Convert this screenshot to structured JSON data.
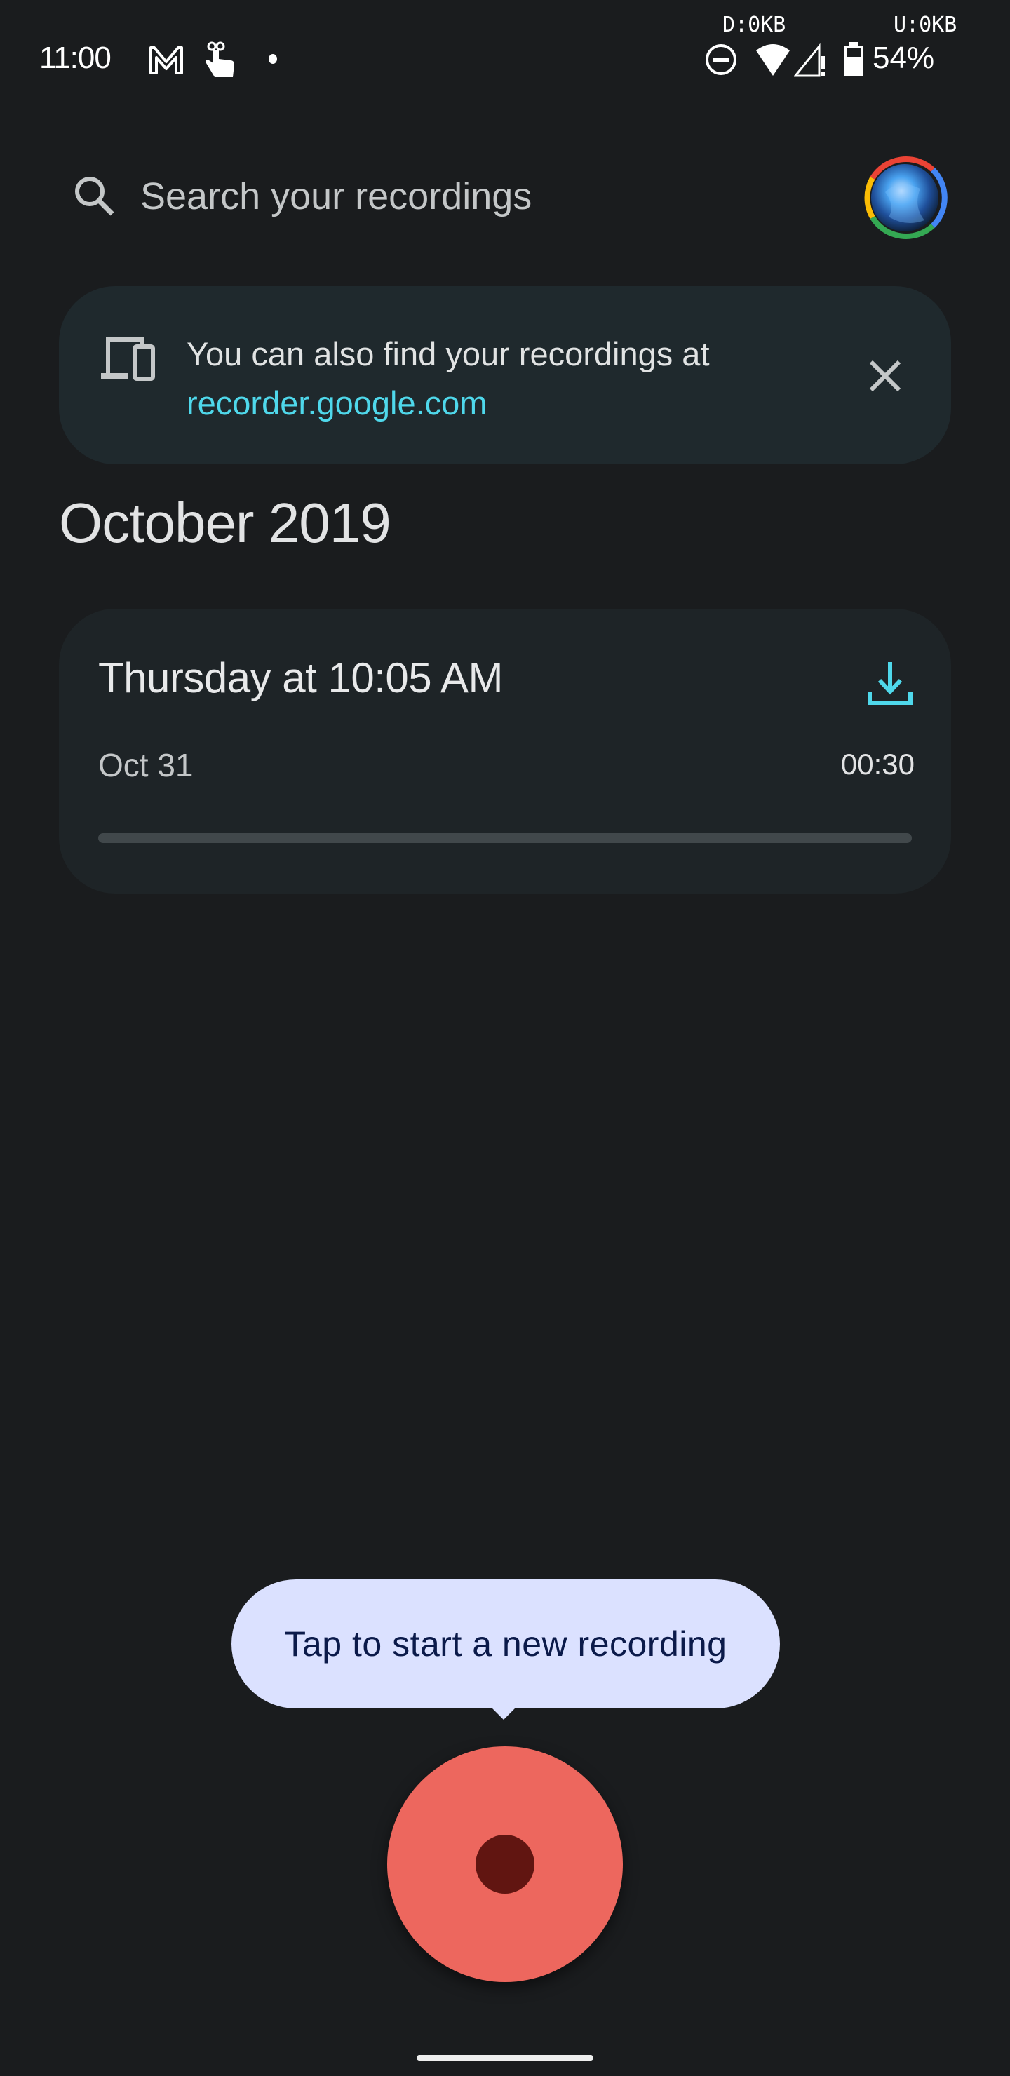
{
  "status_bar": {
    "time": "11:00",
    "notification_icons": [
      "gmail-icon",
      "touch-gesture-icon",
      "more-notifications-dot"
    ],
    "download_rate": "D:0KB",
    "upload_rate": "U:0KB",
    "system_icons": [
      "do-not-disturb-icon",
      "wifi-icon",
      "cellular-no-signal-icon",
      "battery-icon"
    ],
    "battery_percent": "54%"
  },
  "search": {
    "placeholder": "Search your recordings",
    "icon": "search-icon"
  },
  "account": {
    "avatar_ring_colors": [
      "#ea4335",
      "#4285f4",
      "#34a853",
      "#fbbc05"
    ]
  },
  "banner": {
    "icon": "devices-icon",
    "text": "You can also find your recordings at",
    "link": "recorder.google.com",
    "close_icon": "close-icon"
  },
  "sections": [
    {
      "heading": "October 2019",
      "recordings": [
        {
          "title": "Thursday at 10:05 AM",
          "date": "Oct 31",
          "duration": "00:30",
          "playback_progress": 0,
          "action_icon": "download-icon"
        }
      ]
    }
  ],
  "tooltip": {
    "text": "Tap to start a new recording"
  },
  "record_button": {
    "icon": "record-icon"
  },
  "colors": {
    "background": "#1a1c1e",
    "accent": "#4fd8eb",
    "record": "#ed675e",
    "record_dot": "#611511",
    "tooltip_bg": "#dbe1ff",
    "tooltip_text": "#0b1a4a",
    "card_bg": "#1e2427"
  }
}
